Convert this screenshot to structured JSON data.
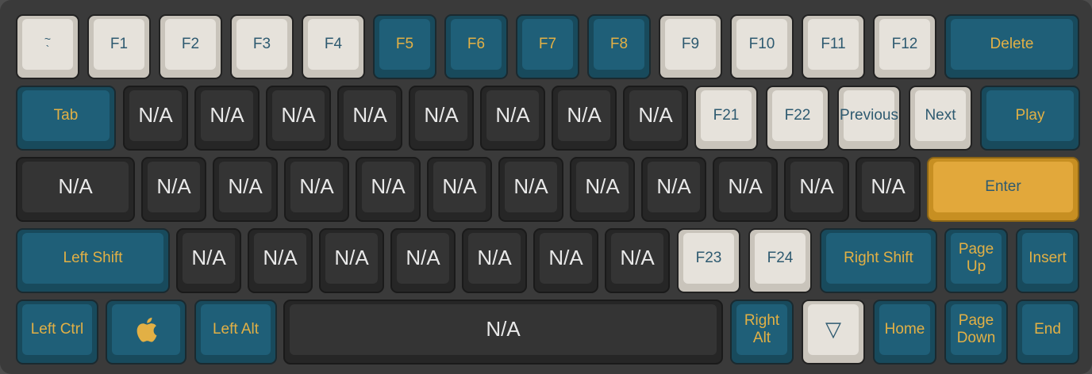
{
  "keyboard": {
    "colors": {
      "board": "#3a3a3a",
      "light_cap": "#e6e2db",
      "blue_cap": "#1f5f78",
      "dark_cap": "#343434",
      "accent_cap": "#e2a83b",
      "blue_legend": "#e2b045",
      "light_legend": "#2e5a70",
      "dark_legend": "#e9e9e9"
    },
    "row1": [
      {
        "label": "~\n`",
        "style": "light"
      },
      {
        "label": "F1",
        "style": "light"
      },
      {
        "label": "F2",
        "style": "light"
      },
      {
        "label": "F3",
        "style": "light"
      },
      {
        "label": "F4",
        "style": "light"
      },
      {
        "label": "F5",
        "style": "blue"
      },
      {
        "label": "F6",
        "style": "blue"
      },
      {
        "label": "F7",
        "style": "blue"
      },
      {
        "label": "F8",
        "style": "blue"
      },
      {
        "label": "F9",
        "style": "light"
      },
      {
        "label": "F10",
        "style": "light"
      },
      {
        "label": "F11",
        "style": "light"
      },
      {
        "label": "F12",
        "style": "light"
      },
      {
        "label": "Delete",
        "style": "blue"
      }
    ],
    "row2": [
      {
        "label": "Tab",
        "style": "blue"
      },
      {
        "label": "N/A",
        "style": "dark"
      },
      {
        "label": "N/A",
        "style": "dark"
      },
      {
        "label": "N/A",
        "style": "dark"
      },
      {
        "label": "N/A",
        "style": "dark"
      },
      {
        "label": "N/A",
        "style": "dark"
      },
      {
        "label": "N/A",
        "style": "dark"
      },
      {
        "label": "N/A",
        "style": "dark"
      },
      {
        "label": "N/A",
        "style": "dark"
      },
      {
        "label": "F21",
        "style": "light"
      },
      {
        "label": "F22",
        "style": "light"
      },
      {
        "label": "Previous",
        "style": "light"
      },
      {
        "label": "Next",
        "style": "light"
      },
      {
        "label": "Play",
        "style": "blue"
      }
    ],
    "row3": [
      {
        "label": "N/A",
        "style": "dark"
      },
      {
        "label": "N/A",
        "style": "dark"
      },
      {
        "label": "N/A",
        "style": "dark"
      },
      {
        "label": "N/A",
        "style": "dark"
      },
      {
        "label": "N/A",
        "style": "dark"
      },
      {
        "label": "N/A",
        "style": "dark"
      },
      {
        "label": "N/A",
        "style": "dark"
      },
      {
        "label": "N/A",
        "style": "dark"
      },
      {
        "label": "N/A",
        "style": "dark"
      },
      {
        "label": "N/A",
        "style": "dark"
      },
      {
        "label": "N/A",
        "style": "dark"
      },
      {
        "label": "N/A",
        "style": "dark"
      },
      {
        "label": "Enter",
        "style": "accent"
      }
    ],
    "row4": [
      {
        "label": "Left Shift",
        "style": "blue"
      },
      {
        "label": "N/A",
        "style": "dark"
      },
      {
        "label": "N/A",
        "style": "dark"
      },
      {
        "label": "N/A",
        "style": "dark"
      },
      {
        "label": "N/A",
        "style": "dark"
      },
      {
        "label": "N/A",
        "style": "dark"
      },
      {
        "label": "N/A",
        "style": "dark"
      },
      {
        "label": "N/A",
        "style": "dark"
      },
      {
        "label": "F23",
        "style": "light"
      },
      {
        "label": "F24",
        "style": "light"
      },
      {
        "label": "Right Shift",
        "style": "blue"
      },
      {
        "label": "Page\nUp",
        "style": "blue"
      },
      {
        "label": "Insert",
        "style": "blue"
      }
    ],
    "row5": [
      {
        "label": "Left Ctrl",
        "style": "blue"
      },
      {
        "label": "",
        "style": "blue",
        "icon": "apple-logo-icon"
      },
      {
        "label": "Left Alt",
        "style": "blue"
      },
      {
        "label": "N/A",
        "style": "dark"
      },
      {
        "label": "Right\nAlt",
        "style": "blue"
      },
      {
        "label": "▽",
        "style": "light",
        "icon": "triangle-down-icon"
      },
      {
        "label": "Home",
        "style": "blue"
      },
      {
        "label": "Page\nDown",
        "style": "blue"
      },
      {
        "label": "End",
        "style": "blue"
      }
    ]
  }
}
